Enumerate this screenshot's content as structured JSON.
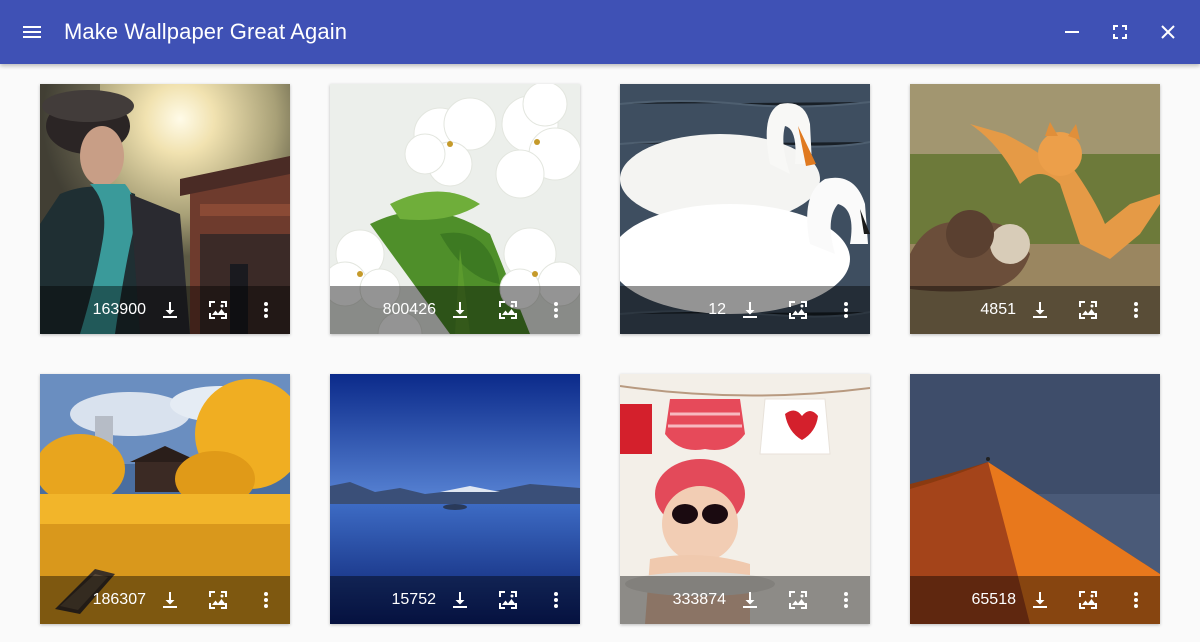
{
  "app": {
    "title": "Make Wallpaper Great Again"
  },
  "toolbar": {
    "menu_icon": "menu-icon",
    "window_controls": [
      "minimize-icon",
      "maximize-icon",
      "close-icon"
    ]
  },
  "wallpapers": [
    {
      "downloads": "163900",
      "subject": "man in traditional embroidered costume, sunlit temple"
    },
    {
      "downloads": "800426",
      "subject": "white cherry blossoms with green leaves"
    },
    {
      "downloads": "12",
      "subject": "two white swans on blue water"
    },
    {
      "downloads": "4851",
      "subject": "orange cat leaping at brown cat on grass"
    },
    {
      "downloads": "186307",
      "subject": "golden autumn trees, lake and wooden boat"
    },
    {
      "downloads": "15752",
      "subject": "deep blue lake with mountains"
    },
    {
      "downloads": "333874",
      "subject": "baby in red bonnet with sunglasses, clothesline"
    },
    {
      "downloads": "65518",
      "subject": "orange sand dune ridge under slate sky"
    }
  ],
  "card_actions": [
    "download-icon",
    "set-wallpaper-icon",
    "more-vert-icon"
  ],
  "colors": {
    "appbar": "#3f51b5",
    "background": "#fafafa",
    "overlay": "rgba(0,0,0,0.42)"
  }
}
